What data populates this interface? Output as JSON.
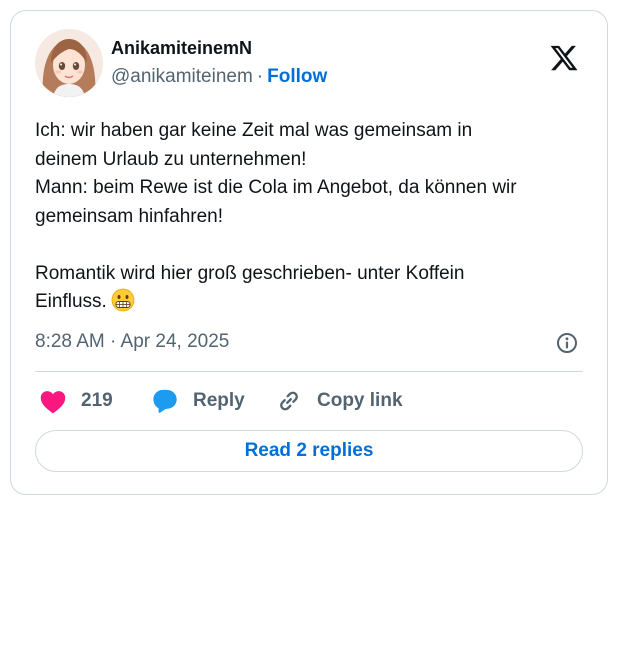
{
  "author": {
    "display_name": "AnikamiteinemN",
    "handle": "@anikamiteinem",
    "separator": "·",
    "follow_label": "Follow",
    "avatar_icon": "anime-girl-avatar"
  },
  "brand": {
    "logo_icon": "x-logo-icon"
  },
  "tweet": {
    "lines": [
      "Ich: wir haben gar keine Zeit mal was gemeinsam in",
      "deinem Urlaub zu unternehmen!",
      "Mann: beim Rewe ist die Cola im Angebot, da können wir",
      "gemeinsam hinfahren!",
      "",
      "Romantik wird hier groß geschrieben- unter Koffein",
      "Einfluss."
    ],
    "emoji_icon": "grimacing-face-icon",
    "timestamp": "8:28 AM · Apr 24, 2025"
  },
  "actions": {
    "like_count": "219",
    "reply_label": "Reply",
    "copy_link_label": "Copy link"
  },
  "replies": {
    "read_label": "Read 2 replies"
  },
  "colors": {
    "accent": "#006fd6",
    "like": "#f91880",
    "reply": "#1d9bf0",
    "muted": "#536471",
    "border": "#cfd9de"
  }
}
